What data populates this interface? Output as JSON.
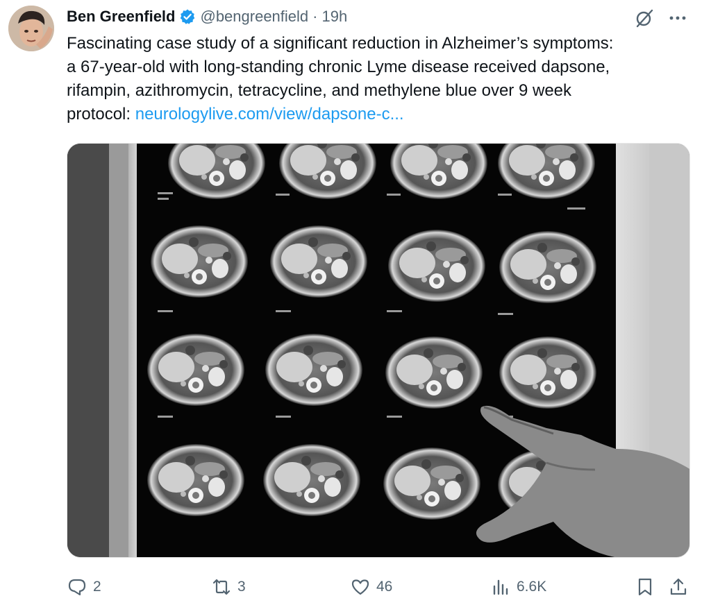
{
  "tweet": {
    "display_name": "Ben Greenfield",
    "handle": "@bengreenfield",
    "separator": "·",
    "time": "19h",
    "text_before_link": "Fascinating case study of a significant reduction in Alzheimer’s symptoms:\na 67-year-old with long-standing chronic Lyme disease received dapsone,\nrifampin, azithromycin, tetracycline, and methylene blue over 9 week\nprotocol: ",
    "link_text": "neurologylive.com/view/dapsone-c...",
    "icons": {
      "verified": "verified-badge-icon",
      "grok": "grok-icon",
      "more": "more-dots-icon"
    }
  },
  "actions": {
    "reply": {
      "icon": "reply-icon",
      "count": "2"
    },
    "retweet": {
      "icon": "retweet-icon",
      "count": "3"
    },
    "like": {
      "icon": "heart-icon",
      "count": "46"
    },
    "views": {
      "icon": "views-chart-icon",
      "count": "6.6K"
    },
    "bookmark": {
      "icon": "bookmark-icon"
    },
    "share": {
      "icon": "share-icon"
    }
  },
  "colors": {
    "text": "#0f1419",
    "secondary": "#536471",
    "link": "#1d9bf0",
    "verified": "#1d9bf0"
  }
}
